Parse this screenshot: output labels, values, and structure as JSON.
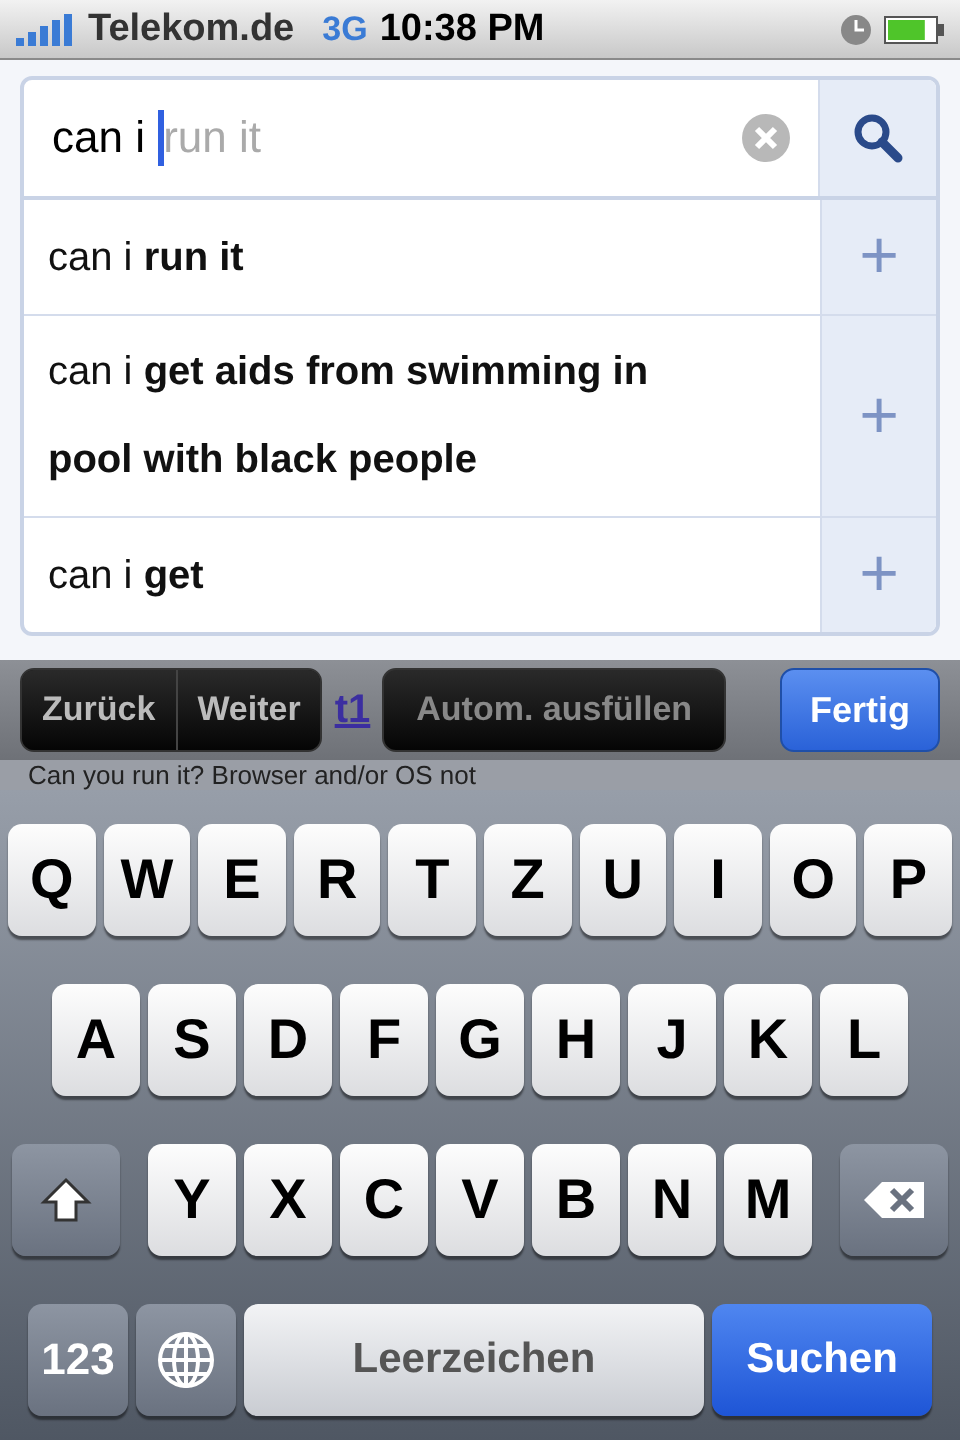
{
  "status_bar": {
    "carrier": "Telekom.de",
    "network": "3G",
    "time": "10:38 PM"
  },
  "search": {
    "value": "can i ",
    "completion": "run it"
  },
  "suggestions": [
    {
      "text": "can i **run it**",
      "action": "+"
    },
    {
      "text": "can i **get aids from swimming in pool with black people**",
      "action": "+"
    },
    {
      "text": "can i **get**",
      "action": "+"
    }
  ],
  "page_behind": {
    "link": "t1",
    "text": "Can you run it? Browser and/or OS not"
  },
  "toolbar": [
    {
      "label": "Zurück",
      "kind": "nav"
    },
    {
      "label": "Weiter",
      "kind": "nav"
    },
    {
      "label": "Autom. ausfüllen",
      "kind": "autofill"
    },
    {
      "label": "Fertig",
      "kind": "done"
    }
  ],
  "keyboard": {
    "rows": [
      {
        "keys": [
          {
            "kind": "letter",
            "label": "Q"
          },
          {
            "kind": "letter",
            "label": "W"
          },
          {
            "kind": "letter",
            "label": "E"
          },
          {
            "kind": "letter",
            "label": "R"
          },
          {
            "kind": "letter",
            "label": "T"
          },
          {
            "kind": "letter",
            "label": "Z"
          },
          {
            "kind": "letter",
            "label": "U"
          },
          {
            "kind": "letter",
            "label": "I"
          },
          {
            "kind": "letter",
            "label": "O"
          },
          {
            "kind": "letter",
            "label": "P"
          }
        ]
      },
      {
        "keys": [
          {
            "kind": "letter",
            "label": "A"
          },
          {
            "kind": "letter",
            "label": "S"
          },
          {
            "kind": "letter",
            "label": "D"
          },
          {
            "kind": "letter",
            "label": "F"
          },
          {
            "kind": "letter",
            "label": "G"
          },
          {
            "kind": "letter",
            "label": "H"
          },
          {
            "kind": "letter",
            "label": "J"
          },
          {
            "kind": "letter",
            "label": "K"
          },
          {
            "kind": "letter",
            "label": "L"
          }
        ]
      },
      {
        "keys": [
          {
            "kind": "shift"
          },
          {
            "kind": "letter",
            "label": "Y"
          },
          {
            "kind": "letter",
            "label": "X"
          },
          {
            "kind": "letter",
            "label": "C"
          },
          {
            "kind": "letter",
            "label": "V"
          },
          {
            "kind": "letter",
            "label": "B"
          },
          {
            "kind": "letter",
            "label": "N"
          },
          {
            "kind": "letter",
            "label": "M"
          },
          {
            "kind": "delete"
          }
        ]
      },
      {
        "keys": [
          {
            "kind": "mode",
            "label": "123"
          },
          {
            "kind": "globe"
          },
          {
            "kind": "space",
            "label": "Leerzeichen"
          },
          {
            "kind": "action",
            "label": "Suchen"
          }
        ]
      }
    ]
  }
}
